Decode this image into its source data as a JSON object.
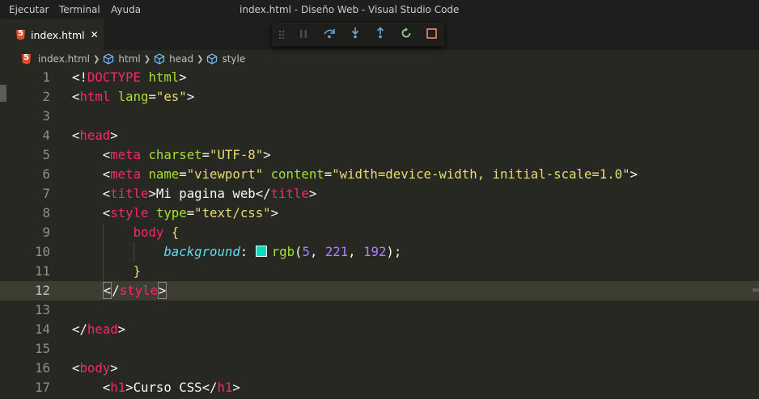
{
  "menubar": {
    "items": [
      "Ejecutar",
      "Terminal",
      "Ayuda"
    ],
    "window_title": "index.html - Diseño Web - Visual Studio Code"
  },
  "tabs": [
    {
      "label": "index.html",
      "icon": "html5-icon",
      "close": "✕",
      "active": true
    }
  ],
  "debug_toolbar": {
    "buttons": [
      "drag-grip",
      "pause",
      "step-over",
      "step-into",
      "step-out",
      "restart",
      "stop"
    ],
    "colors": {
      "default": "#75beff",
      "restart": "#89d185",
      "stop": "#f48771"
    }
  },
  "breadcrumb": {
    "file": "index.html",
    "items": [
      "html",
      "head",
      "style"
    ]
  },
  "editor": {
    "current_line": 12,
    "color_swatch": "#05ddc0",
    "lines": [
      {
        "num": "1",
        "tokens": [
          [
            "<!",
            "p"
          ],
          [
            "DOCTYPE",
            "t"
          ],
          [
            " ",
            "p"
          ],
          [
            "html",
            "a"
          ],
          [
            ">",
            "p"
          ]
        ]
      },
      {
        "num": "2",
        "tokens": [
          [
            "<",
            "p"
          ],
          [
            "html",
            "t"
          ],
          [
            " ",
            "p"
          ],
          [
            "lang",
            "a"
          ],
          [
            "=",
            "p"
          ],
          [
            "\"es\"",
            "s"
          ],
          [
            ">",
            "p"
          ]
        ]
      },
      {
        "num": "3",
        "tokens": []
      },
      {
        "num": "4",
        "tokens": [
          [
            "<",
            "p"
          ],
          [
            "head",
            "t"
          ],
          [
            ">",
            "p"
          ]
        ]
      },
      {
        "num": "5",
        "tokens": [
          [
            "    ",
            "p"
          ],
          [
            "<",
            "p"
          ],
          [
            "meta",
            "t"
          ],
          [
            " ",
            "p"
          ],
          [
            "charset",
            "a"
          ],
          [
            "=",
            "p"
          ],
          [
            "\"UTF-8\"",
            "s"
          ],
          [
            ">",
            "p"
          ]
        ]
      },
      {
        "num": "6",
        "tokens": [
          [
            "    ",
            "p"
          ],
          [
            "<",
            "p"
          ],
          [
            "meta",
            "t"
          ],
          [
            " ",
            "p"
          ],
          [
            "name",
            "a"
          ],
          [
            "=",
            "p"
          ],
          [
            "\"viewport\"",
            "s"
          ],
          [
            " ",
            "p"
          ],
          [
            "content",
            "a"
          ],
          [
            "=",
            "p"
          ],
          [
            "\"width=device-width, initial-scale=1.0\"",
            "s"
          ],
          [
            ">",
            "p"
          ]
        ]
      },
      {
        "num": "7",
        "tokens": [
          [
            "    ",
            "p"
          ],
          [
            "<",
            "p"
          ],
          [
            "title",
            "t"
          ],
          [
            ">",
            "p"
          ],
          [
            "Mi pagina web",
            "p"
          ],
          [
            "</",
            "p"
          ],
          [
            "title",
            "t"
          ],
          [
            ">",
            "p"
          ]
        ]
      },
      {
        "num": "8",
        "tokens": [
          [
            "    ",
            "p"
          ],
          [
            "<",
            "p"
          ],
          [
            "style",
            "t"
          ],
          [
            " ",
            "p"
          ],
          [
            "type",
            "a"
          ],
          [
            "=",
            "p"
          ],
          [
            "\"text/css\"",
            "s"
          ],
          [
            ">",
            "p"
          ]
        ]
      },
      {
        "num": "9",
        "tokens": [
          [
            "        ",
            "p"
          ],
          [
            "body",
            "t"
          ],
          [
            " {",
            "s"
          ]
        ]
      },
      {
        "num": "10",
        "tokens": [
          [
            "            ",
            "p"
          ],
          [
            "background",
            "c"
          ],
          [
            ": ",
            "p"
          ],
          [
            "",
            "swatch"
          ],
          [
            "rgb",
            "a"
          ],
          [
            "(",
            "p"
          ],
          [
            "5",
            "n"
          ],
          [
            ", ",
            "p"
          ],
          [
            "221",
            "n"
          ],
          [
            ", ",
            "p"
          ],
          [
            "192",
            "n"
          ],
          [
            ");",
            "p"
          ]
        ]
      },
      {
        "num": "11",
        "tokens": [
          [
            "        ",
            "p"
          ],
          [
            "}",
            "s"
          ]
        ]
      },
      {
        "num": "12",
        "tokens": [
          [
            "    ",
            "p"
          ],
          [
            "<",
            "br"
          ],
          [
            "/",
            "p"
          ],
          [
            "style",
            "t"
          ],
          [
            ">",
            "br"
          ]
        ]
      },
      {
        "num": "13",
        "tokens": []
      },
      {
        "num": "14",
        "tokens": [
          [
            "</",
            "p"
          ],
          [
            "head",
            "t"
          ],
          [
            ">",
            "p"
          ]
        ]
      },
      {
        "num": "15",
        "tokens": []
      },
      {
        "num": "16",
        "tokens": [
          [
            "<",
            "p"
          ],
          [
            "body",
            "t"
          ],
          [
            ">",
            "p"
          ]
        ]
      },
      {
        "num": "17",
        "tokens": [
          [
            "    ",
            "p"
          ],
          [
            "<",
            "p"
          ],
          [
            "h1",
            "t"
          ],
          [
            ">",
            "p"
          ],
          [
            "Curso CSS",
            "p"
          ],
          [
            "</",
            "p"
          ],
          [
            "h1",
            "t"
          ],
          [
            ">",
            "p"
          ]
        ]
      }
    ]
  }
}
